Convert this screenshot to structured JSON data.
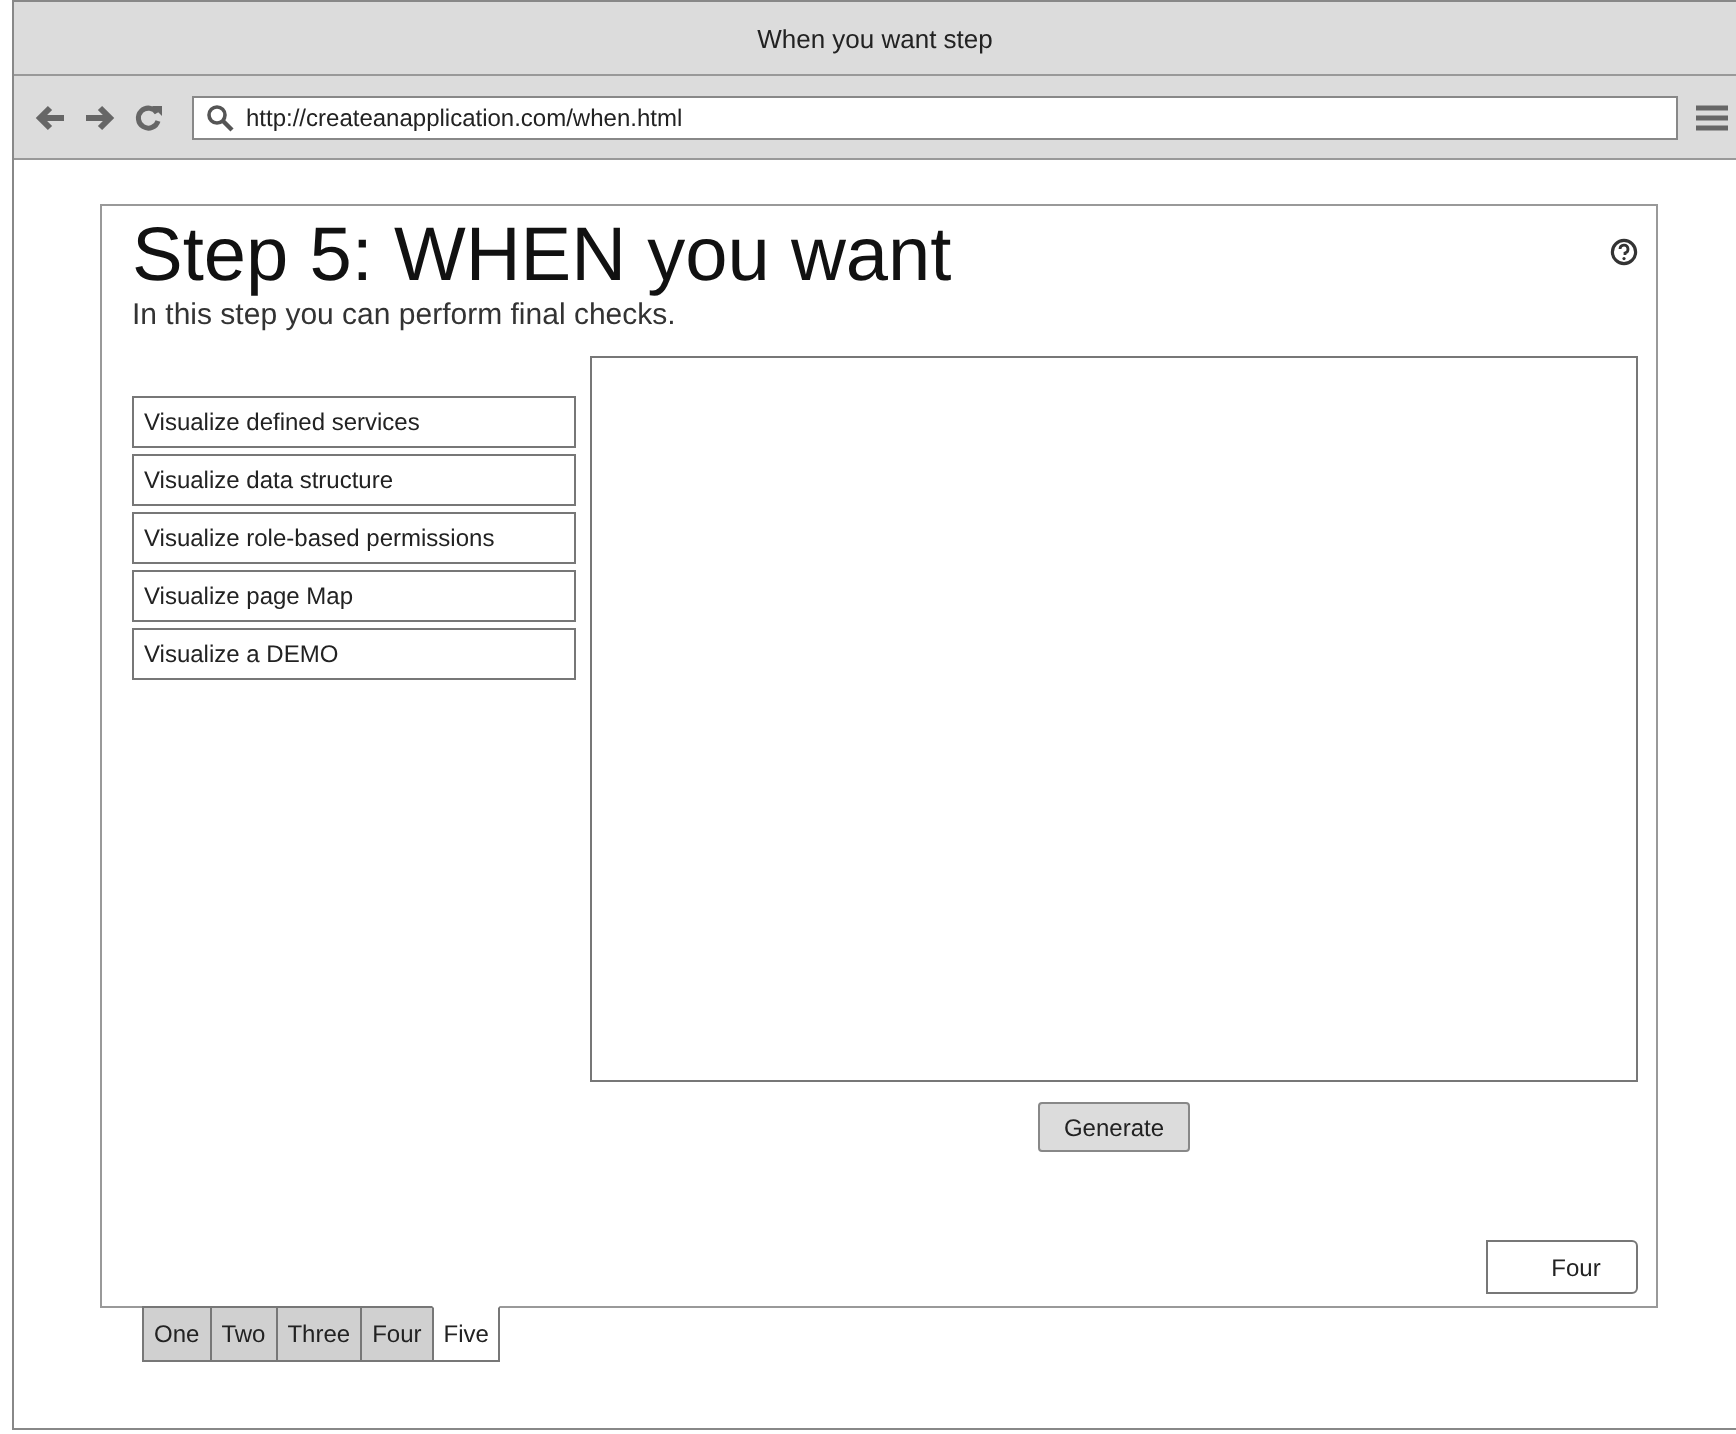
{
  "window": {
    "title": "When you want step"
  },
  "browser": {
    "url": "http://createanapplication.com/when.html"
  },
  "page": {
    "title": "Step 5: WHEN you want",
    "subtitle": "In this step you can perform final checks.",
    "actions": [
      "Visualize defined services",
      "Visualize data structure",
      "Visualize role-based permissions",
      "Visualize page Map",
      "Visualize a DEMO"
    ],
    "generate_button": "Generate",
    "back_button": "Four"
  },
  "tabs": [
    {
      "label": "One",
      "selected": false
    },
    {
      "label": "Two",
      "selected": false
    },
    {
      "label": "Three",
      "selected": false
    },
    {
      "label": "Four",
      "selected": false
    },
    {
      "label": "Five",
      "selected": true
    }
  ]
}
